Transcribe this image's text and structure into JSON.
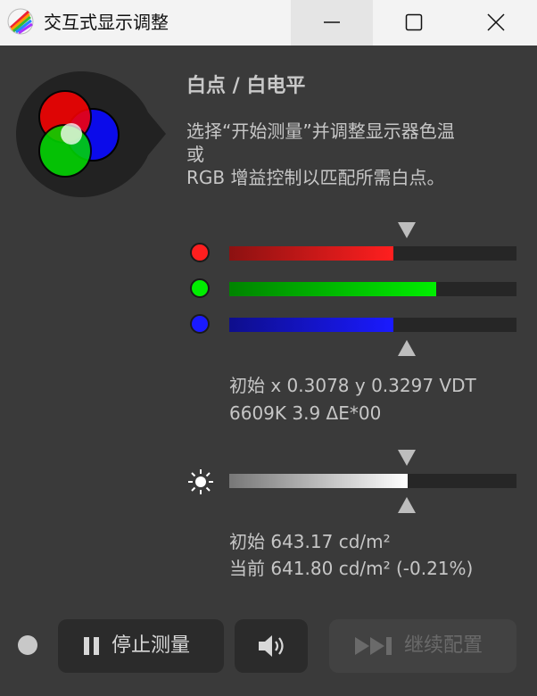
{
  "window": {
    "title": "交互式显示调整",
    "icon": "display-calibration-app-icon",
    "controls": [
      "minimize-icon",
      "maximize-icon",
      "close-icon"
    ]
  },
  "header": {
    "title": "白点 / 白电平",
    "description_lines": [
      "选择“开始测量”并调整显示器色温",
      "或",
      "RGB 增益控制以匹配所需白点。"
    ]
  },
  "rgb_gain": {
    "target_level": 0.62,
    "channels": [
      {
        "name": "R",
        "color": "#ff1f1f",
        "level": 0.57
      },
      {
        "name": "G",
        "color": "#00ee00",
        "level": 0.72
      },
      {
        "name": "B",
        "color": "#1a1aff",
        "level": 0.57
      }
    ]
  },
  "whitepoint_info": {
    "line1": "初始 x 0.3078 y 0.3297 VDT",
    "line2": "6609K 3.9 ΔE*00"
  },
  "luminance": {
    "icon": "sun-icon",
    "level": 0.62,
    "target_level": 0.62,
    "line1": "初始 643.17 cd/m²",
    "line2": "当前 641.80 cd/m² (-0.21%)"
  },
  "footer": {
    "stop_label": "停止测量",
    "stop_icon": "pause-icon",
    "sound_icon": "speaker-icon",
    "continue_label": "继续配置",
    "continue_icon": "skip-forward-icon"
  }
}
